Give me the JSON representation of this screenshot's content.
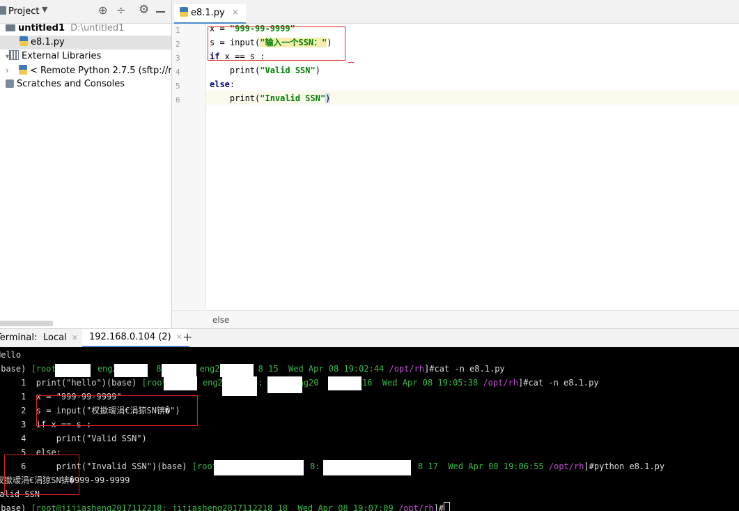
{
  "project": {
    "title": "Project",
    "tree": [
      {
        "label": "untitled1",
        "path": "D:\\untitled1"
      },
      {
        "label": "e8.1.py"
      },
      {
        "label": "External Libraries"
      },
      {
        "label": "< Remote Python 2.7.5 (sftp://root"
      },
      {
        "label": "Scratches and Consoles"
      }
    ]
  },
  "editor": {
    "tab": "e8.1.py",
    "lines": [
      {
        "num": "1",
        "a": "x = ",
        "b": "\"999-99-9999\""
      },
      {
        "num": "2",
        "a": "s = input(",
        "b": "\"输入一个SSN：\"",
        "c": ")"
      },
      {
        "num": "3",
        "kw": "if",
        "a": " x == s :"
      },
      {
        "num": "4",
        "a": "    print(",
        "b": "\"Valid SSN\"",
        "c": ")"
      },
      {
        "num": "5",
        "kw": "else",
        "a": ":"
      },
      {
        "num": "6",
        "a": "    print(",
        "b": "\"Invalid SSN\"",
        "c": ")"
      }
    ],
    "breadcrumb": "else"
  },
  "terminal": {
    "label": "Terminal:",
    "tabs": [
      "Local",
      "192.168.0.104 (2)"
    ],
    "add": "+",
    "lines": {
      "l1": "Hello",
      "l2a": "(base) ",
      "l2b": "[root@",
      "l2c": "eng20",
      "l2d": "8:",
      "l2e": "eng20",
      "l2f": "8 15  Wed Apr 08 19:02:44 ",
      "l2g": "/opt/rh",
      "l2h": "]#cat -n e8.1.py",
      "l3a": "     1  print(\"hello\")(base) ",
      "l3b": "[root@",
      "l3c": "eng20",
      "l3d": "8:",
      "l3e": "eng20",
      "l3f": "8 16  Wed Apr 08 19:05:38 ",
      "l3g": "/opt/rh",
      "l3h": "]#cat -n e8.1.py",
      "l4": "     1  x = \"999-99-9999\"",
      "l5": "     2  s = input(\"杈撳叆涓€涓猄SN锛�\")",
      "l6": "     3  if x == s :",
      "l7": "     4      print(\"Valid SSN\")",
      "l8": "     5  else:",
      "l9a": "     6      print(\"Invalid SSN\")(base) ",
      "l9b": "[root@",
      "l9c": "8: j",
      "l9d": "8 17  Wed Apr 08 19:06:55 ",
      "l9e": "/opt/rh",
      "l9f": "]#python e8.1.py",
      "l10": "杈撳叆涓€涓猄SN锛�999-99-9999",
      "l11": "Valid SSN",
      "l12a": "(base) ",
      "l12b": "[root@jijiasheng2017112218: jijiasheng2017112218 18  Wed Apr 08 19:07:09 ",
      "l12c": "/opt/rh",
      "l12d": "]#"
    }
  }
}
